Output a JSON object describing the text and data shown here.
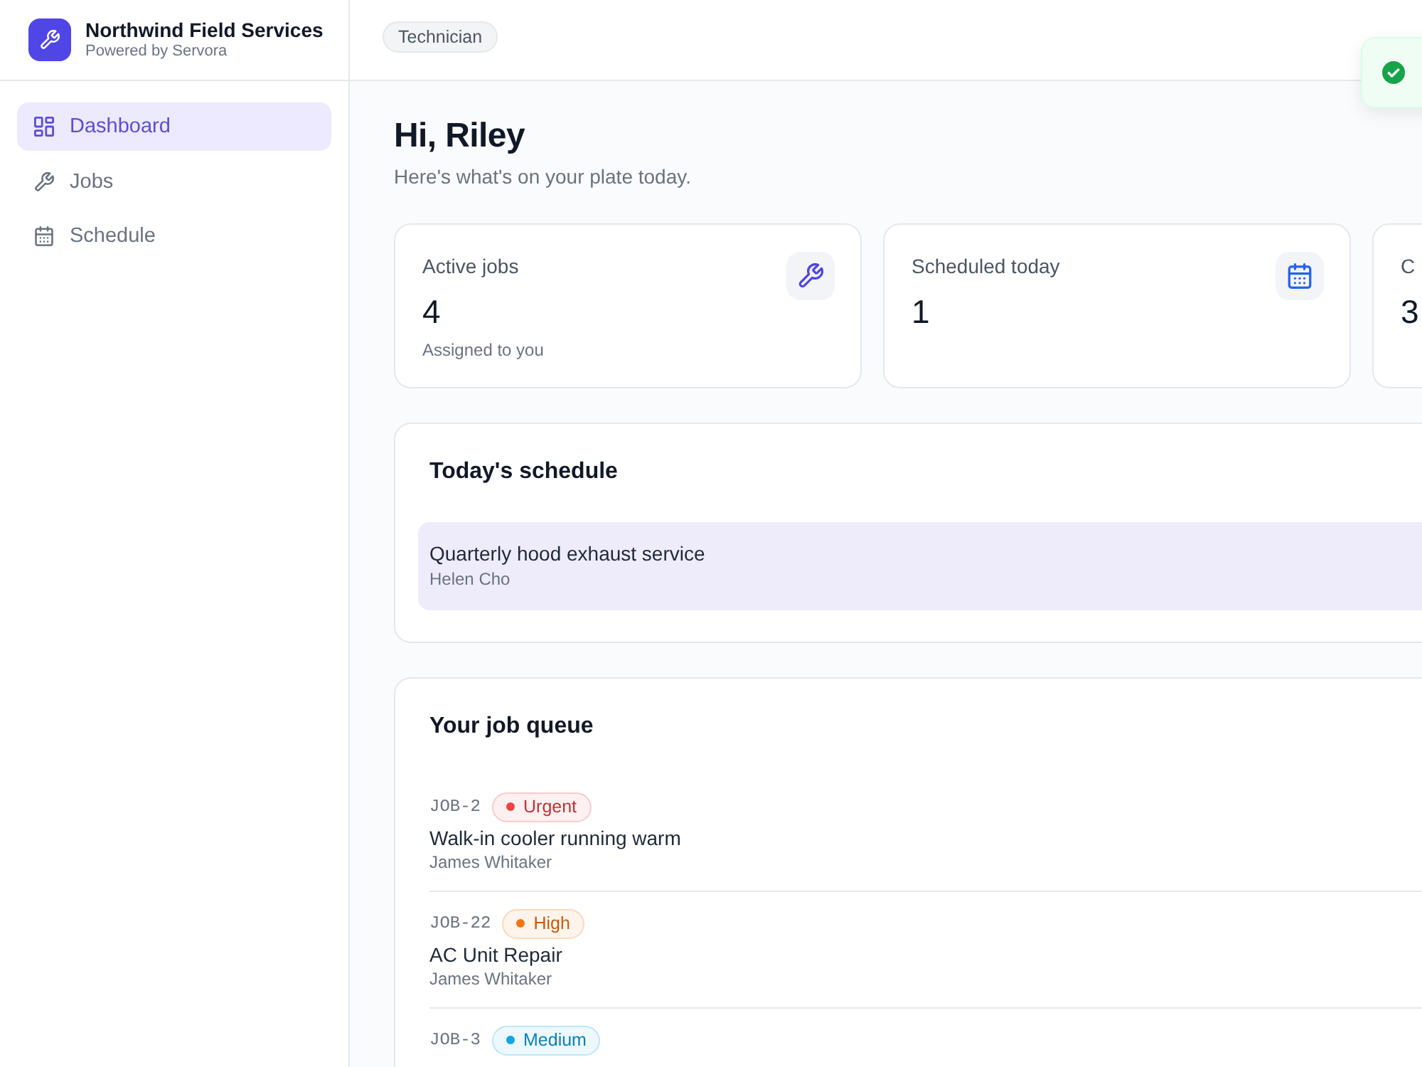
{
  "sidebar": {
    "brand": {
      "name": "Northwind Field Services",
      "tagline": "Powered by Servora"
    },
    "nav": [
      {
        "label": "Dashboard",
        "selected": true
      },
      {
        "label": "Jobs",
        "selected": false
      },
      {
        "label": "Schedule",
        "selected": false
      }
    ]
  },
  "header": {
    "role_badge": "Technician"
  },
  "toast": {
    "kind": "success"
  },
  "greeting": {
    "title": "Hi, Riley",
    "subtitle": "Here's what's on your plate today."
  },
  "stats": [
    {
      "label": "Active jobs",
      "value": "4",
      "note": "Assigned to you"
    },
    {
      "label": "Scheduled today",
      "value": "1"
    },
    {
      "label": "C",
      "value": "3"
    }
  ],
  "schedule": {
    "title": "Today's schedule",
    "items": [
      {
        "title": "Quarterly hood exhaust service",
        "customer": "Helen Cho",
        "hovered": true
      }
    ]
  },
  "job_queue": {
    "title": "Your job queue",
    "items": [
      {
        "id": "JOB-2",
        "priority": "Urgent",
        "color": "#ef4444",
        "title": "Walk-in cooler running warm",
        "customer": "James Whitaker"
      },
      {
        "id": "JOB-22",
        "priority": "High",
        "color": "#f97316",
        "title": "AC Unit Repair",
        "customer": "James Whitaker"
      },
      {
        "id": "JOB-3",
        "priority": "Medium",
        "color": "#0ea5e9"
      }
    ]
  }
}
